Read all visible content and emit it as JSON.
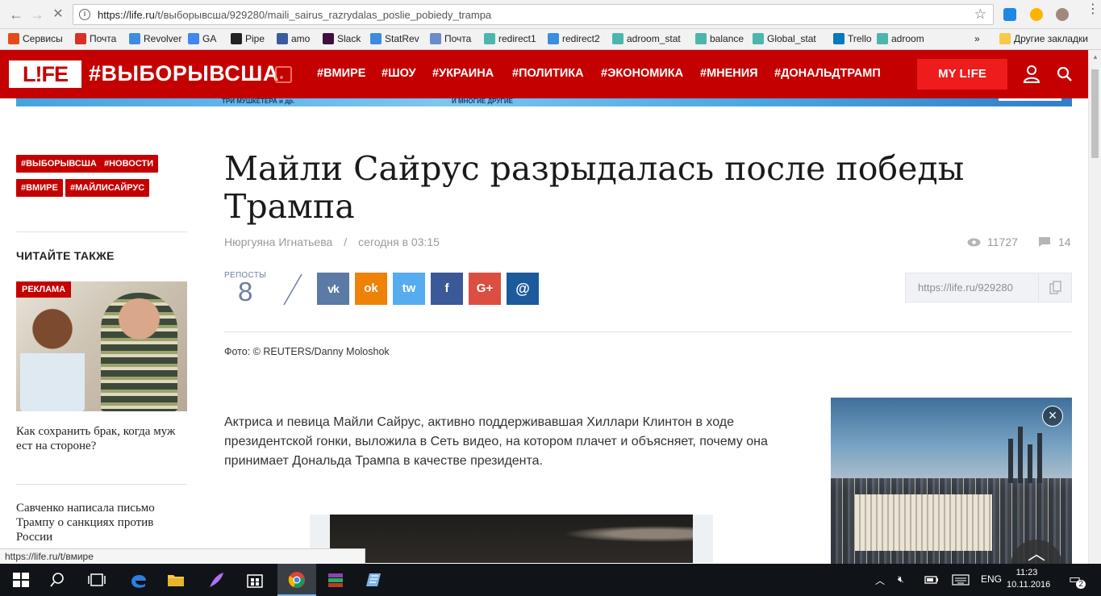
{
  "browser": {
    "url_host": "https://life.ru",
    "url_path": "/t/выборывсша/929280/maili_sairus_razrydalas_poslie_pobiedy_trampa",
    "status_url": "https://life.ru/t/вмире"
  },
  "bookmarks": [
    {
      "label": "Сервисы",
      "icon": "apps-grid-icon",
      "color": "#e64a19"
    },
    {
      "label": "Почта",
      "icon": "gmail-icon",
      "color": "#d93025"
    },
    {
      "label": "Revolver",
      "icon": "revolver-icon",
      "color": "#3c8dde"
    },
    {
      "label": "GA",
      "icon": "google-icon",
      "color": "#4285f4"
    },
    {
      "label": "Pipe",
      "icon": "pipe-icon",
      "color": "#222222"
    },
    {
      "label": "amo",
      "icon": "amo-icon",
      "color": "#3a5ba0"
    },
    {
      "label": "Slack",
      "icon": "slack-icon",
      "color": "#3f0f3f"
    },
    {
      "label": "StatRev",
      "icon": "revolver-icon",
      "color": "#3c8dde"
    },
    {
      "label": "Почта",
      "icon": "mail-icon",
      "color": "#6b8cc7"
    },
    {
      "label": "redirect1",
      "icon": "adroom-icon",
      "color": "#4db6ac"
    },
    {
      "label": "redirect2",
      "icon": "revolver-icon",
      "color": "#3c8dde"
    },
    {
      "label": "adroom_stat",
      "icon": "adroom-icon",
      "color": "#4db6ac"
    },
    {
      "label": "balance",
      "icon": "adroom-icon",
      "color": "#4db6ac"
    },
    {
      "label": "Global_stat",
      "icon": "adroom-icon",
      "color": "#4db6ac"
    },
    {
      "label": "Trello",
      "icon": "trello-icon",
      "color": "#0079bf"
    },
    {
      "label": "adroom",
      "icon": "adroom-icon",
      "color": "#4db6ac"
    }
  ],
  "bookmarks_more": "»",
  "bookmarks_other": "Другие закладки",
  "site": {
    "logo": "L!FE",
    "title": "#ВЫБОРЫВСША",
    "nav": [
      "#ВМИРЕ",
      "#ШОУ",
      "#УКРАИНА",
      "#ПОЛИТИКА",
      "#ЭКОНОМИКА",
      "#МНЕНИЯ",
      "#ДОНАЛЬДТРАМП"
    ],
    "my_life": "MY L!FE",
    "accent": "#c50000"
  },
  "banner_texts": [
    "ТРИ МУШКЕТЕРА и др.",
    "И МНОГИЕ ДРУГИЕ"
  ],
  "tags": [
    "#ВЫБОРЫВСША",
    "#НОВОСТИ",
    "#ВМИРЕ",
    "#МАЙЛИСАЙРУС"
  ],
  "sidebar": {
    "read_also": "ЧИТАЙТЕ ТАКЖЕ",
    "ad_label": "РЕКЛАМА",
    "promo_title": "Как сохранить брак, когда муж ест на стороне?",
    "news_title": "Савченко написала письмо Трампу о санкциях против России"
  },
  "article": {
    "headline": "Майли Сайрус разрыдалась после победы Трампа",
    "author": "Нюргуяна Игнатьева",
    "separator": "/",
    "time": "сегодня в 03:15",
    "views": "11727",
    "comments": "14",
    "reposts_label": "РЕПОСТЫ",
    "reposts_count": "8",
    "share_buttons": [
      {
        "icon": "vk-icon",
        "label": "vk",
        "color": "#5b7aa5"
      },
      {
        "icon": "odnoklassniki-icon",
        "label": "ok",
        "color": "#ee8208"
      },
      {
        "icon": "twitter-icon",
        "label": "tw",
        "color": "#55acee"
      },
      {
        "icon": "facebook-icon",
        "label": "f",
        "color": "#3b5998"
      },
      {
        "icon": "google-plus-icon",
        "label": "G+",
        "color": "#dc4e41"
      },
      {
        "icon": "mail-ru-icon",
        "label": "@",
        "color": "#1c5a9b"
      }
    ],
    "short_link": "https://life.ru/929280",
    "photo_credit": "Фото: © REUTERS/Danny Moloshok",
    "lead": "Актриса и певица Майли Сайрус, активно поддерживавшая Хиллари Клинтон в ходе президентской гонки, выложила в Сеть видео, на котором плачет и объясняет, почему она принимает Дональда Трампа в качестве президента."
  },
  "taskbar": {
    "language": "ENG",
    "time": "11:23",
    "date": "10.11.2016",
    "notifications": "2"
  }
}
